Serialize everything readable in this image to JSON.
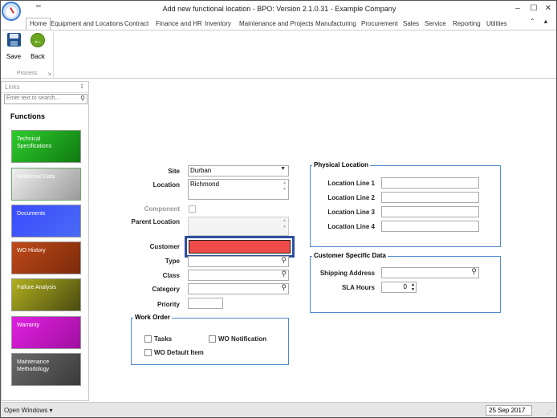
{
  "window": {
    "title": "Add new functional location - BPO: Version 2.1.0.31 - Example Company",
    "minimize": "–",
    "maximize": "☐",
    "close": "✕",
    "quick_access": "═"
  },
  "ribbon": {
    "tabs": [
      "Home",
      "Equipment and Locations",
      "Contract",
      "Finance and HR",
      "Inventory",
      "Maintenance and Projects",
      "Manufacturing",
      "Procurement",
      "Sales",
      "Service",
      "Reporting",
      "Utilities"
    ],
    "active_tab": "Home",
    "tab_controls": [
      "⌃",
      "▲"
    ],
    "buttons": {
      "save_label": "Save",
      "back_label": "Back"
    },
    "group_label": "Process"
  },
  "links_panel": {
    "header": "Links",
    "pin": "↧",
    "search_placeholder": "Enter text to search...",
    "functions_heading": "Functions",
    "tiles": [
      {
        "label": "Technical Specifications",
        "color": "#1a9a1a"
      },
      {
        "label": "Additional Data",
        "color": "#a8a8a8"
      },
      {
        "label": "Documents",
        "color": "#2f3fe0"
      },
      {
        "label": "WO History",
        "color": "#b5401a"
      },
      {
        "label": "Failure Analysis",
        "color": "#8a8a14"
      },
      {
        "label": "Warranty",
        "color": "#c018c0"
      },
      {
        "label": "Maintenance Methodology",
        "color": "#5a5a5a"
      }
    ]
  },
  "form": {
    "site_label": "Site",
    "site_value": "Durban",
    "location_label": "Location",
    "location_value": "Richmond",
    "component_label": "Component",
    "parent_location_label": "Parent Location",
    "customer_label": "Customer",
    "type_label": "Type",
    "class_label": "Class",
    "category_label": "Category",
    "priority_label": "Priority",
    "highlight_color": "#2d4fa0",
    "customer_fill": "#f04a4a",
    "work_order": {
      "legend": "Work Order",
      "tasks": "Tasks",
      "wo_notification": "WO Notification",
      "wo_default_item": "WO Default Item"
    },
    "physical_location": {
      "legend": "Physical Location",
      "line1": "Location Line 1",
      "line2": "Location Line 2",
      "line3": "Location Line 3",
      "line4": "Location Line 4"
    },
    "customer_specific": {
      "legend": "Customer Specific Data",
      "shipping_address": "Shipping Address",
      "sla_hours": "SLA Hours",
      "sla_value": "0"
    }
  },
  "statusbar": {
    "open_windows": "Open Windows ▾",
    "date": "25 Sep 2017",
    "grip": "⋰"
  }
}
